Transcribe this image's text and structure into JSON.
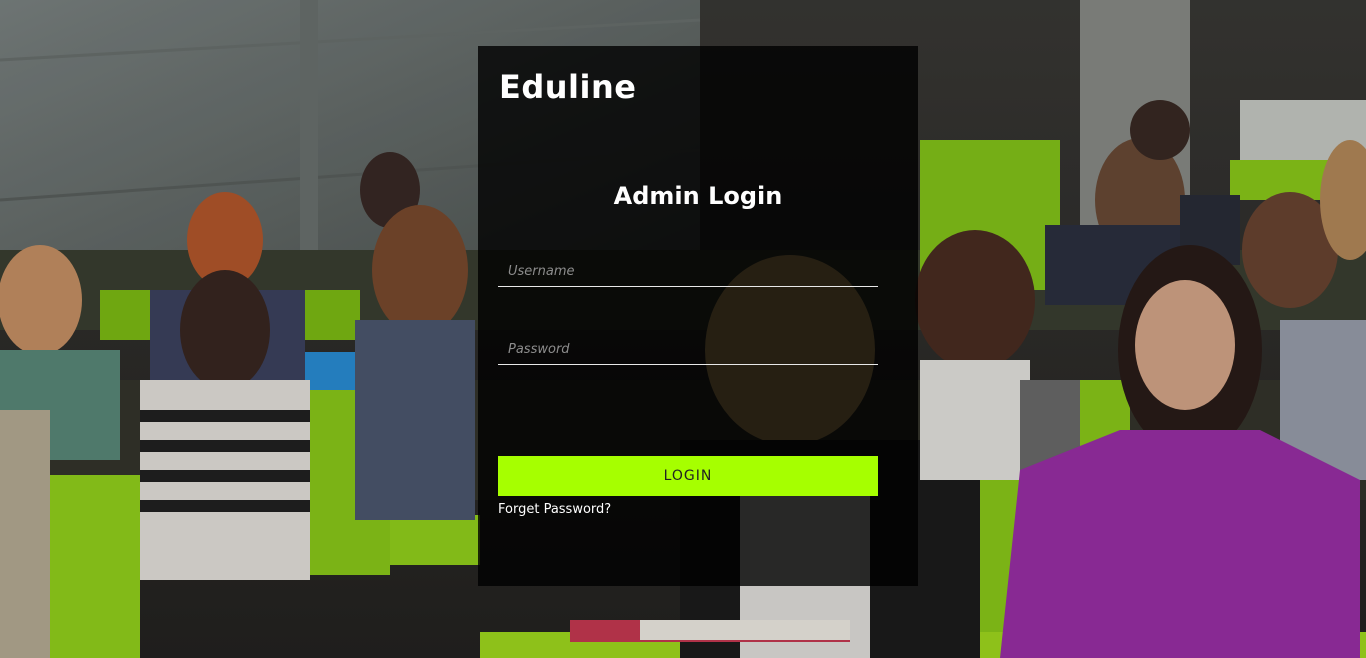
{
  "brand": {
    "name": "Eduline"
  },
  "login": {
    "title": "Admin Login",
    "username_placeholder": "Username",
    "username_value": "",
    "password_placeholder": "Password",
    "password_value": "",
    "submit_label": "LOGIN",
    "forgot_label": "Forget Password?"
  },
  "colors": {
    "accent": "#a6ff00",
    "panel": "rgba(0,0,0,0.80)",
    "seat_green": "#8ccc1a",
    "purple_jacket": "#9b2fa8"
  }
}
